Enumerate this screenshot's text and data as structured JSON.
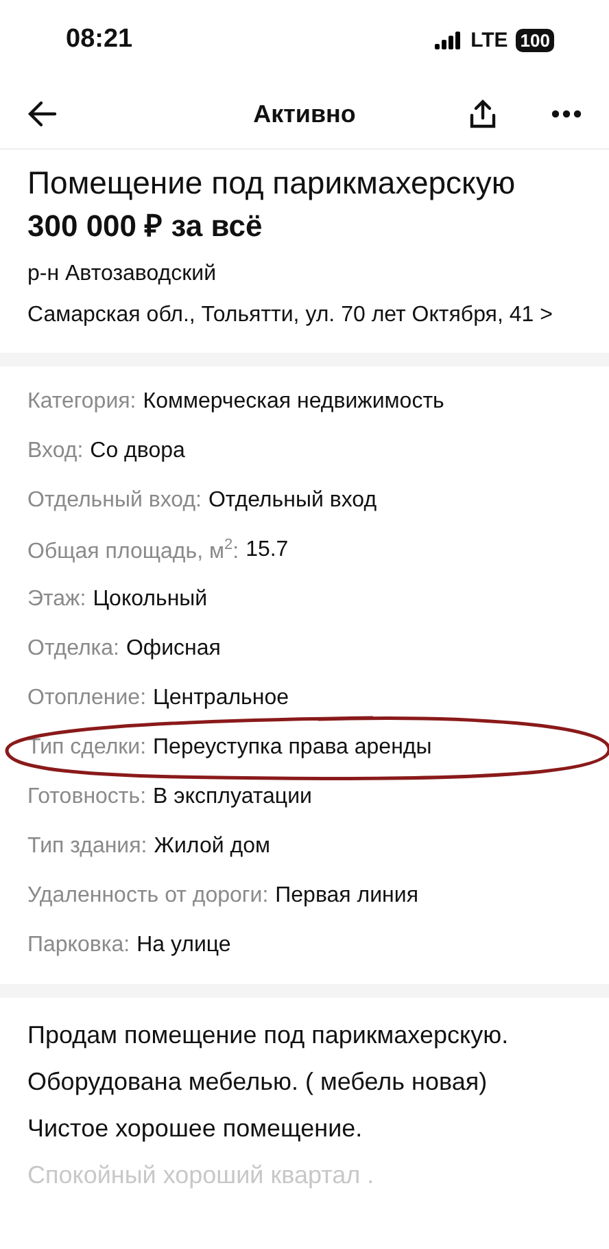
{
  "status_bar": {
    "time": "08:21",
    "network": "LTE",
    "battery": "100"
  },
  "header": {
    "title": "Активно"
  },
  "listing": {
    "title": "Помещение под парикмахерскую",
    "price": "300 000 ₽ за всё",
    "district": "р-н Автозаводский",
    "address": "Самарская обл., Тольятти, ул. 70 лет Октября, 41",
    "address_arrow": ">"
  },
  "params": [
    {
      "label": "Категория:",
      "value": "Коммерческая недвижимость",
      "circled": false
    },
    {
      "label": "Вход:",
      "value": "Со двора",
      "circled": false
    },
    {
      "label": "Отдельный вход:",
      "value": "Отдельный вход",
      "circled": false
    },
    {
      "label": "Общая площадь, м$^{2}$:",
      "value": "15.7",
      "circled": false
    },
    {
      "label": "Этаж:",
      "value": "Цокольный",
      "circled": false
    },
    {
      "label": "Отделка:",
      "value": "Офисная",
      "circled": false
    },
    {
      "label": "Отопление:",
      "value": "Центральное",
      "circled": false
    },
    {
      "label": "Тип сделки:",
      "value": "Переуступка права аренды",
      "circled": true
    },
    {
      "label": "Готовность:",
      "value": "В эксплуатации",
      "circled": false
    },
    {
      "label": "Тип здания:",
      "value": "Жилой дом",
      "circled": false
    },
    {
      "label": "Удаленность от дороги:",
      "value": "Первая линия",
      "circled": false
    },
    {
      "label": "Парковка:",
      "value": "На улице",
      "circled": false
    }
  ],
  "description": {
    "lines": [
      "Продам помещение под парикмахерскую.",
      "Оборудована мебелью. ( мебель новая)",
      "Чистое хорошее помещение.",
      "Спокойный хороший квартал ."
    ],
    "faded_last_line": true
  }
}
